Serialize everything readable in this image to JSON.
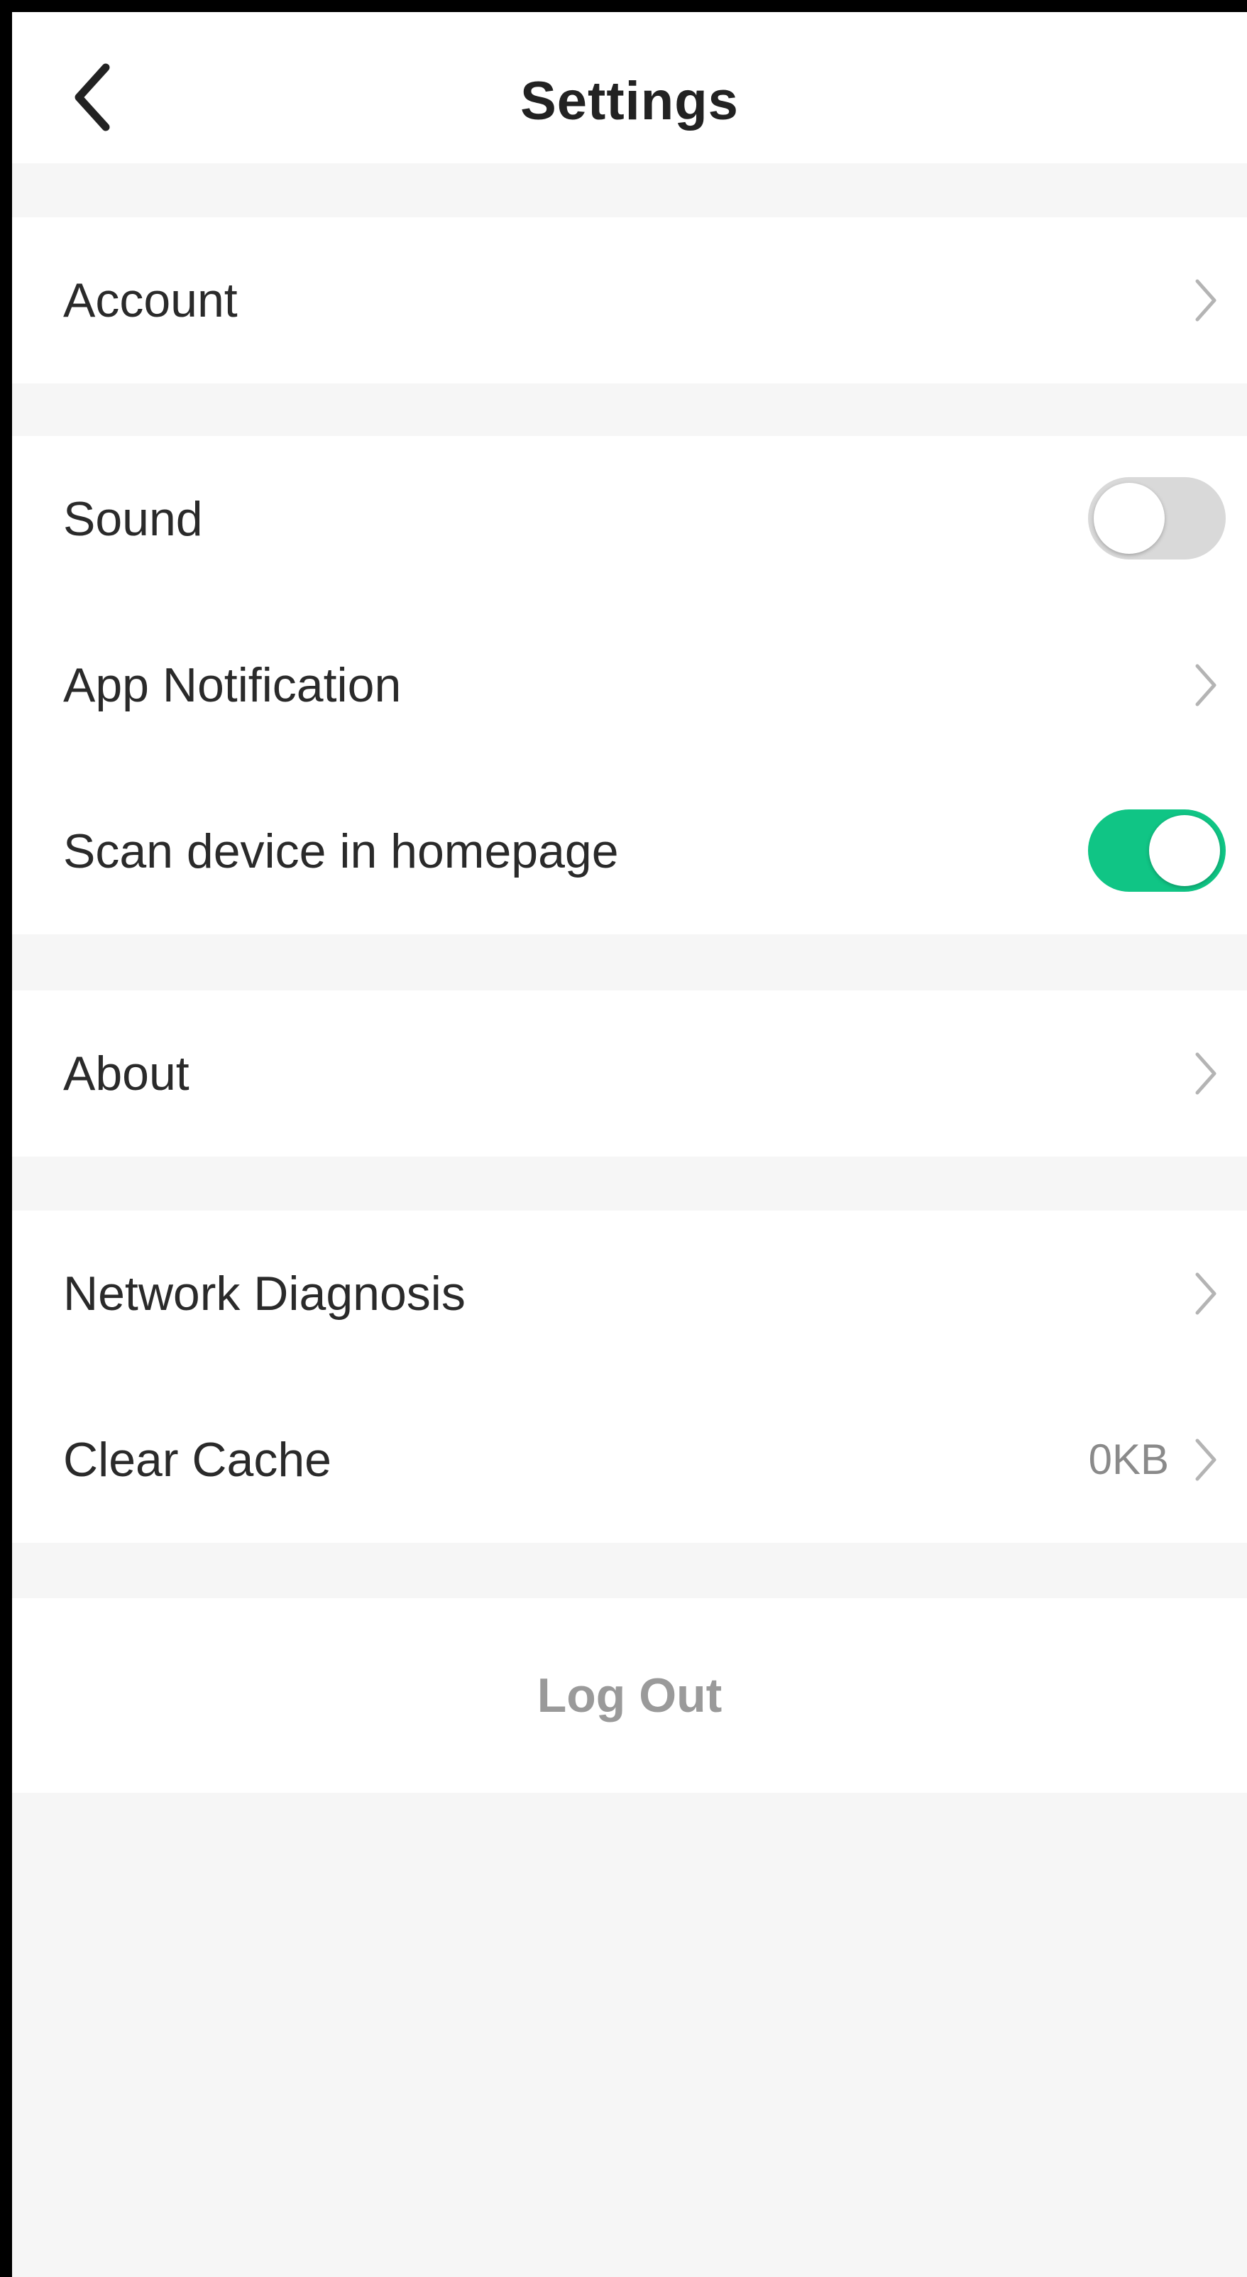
{
  "header": {
    "title": "Settings",
    "back_icon": "chevron-left-icon"
  },
  "sections": {
    "account": {
      "label": "Account"
    },
    "sound": {
      "label": "Sound",
      "enabled": false
    },
    "app_notification": {
      "label": "App Notification"
    },
    "scan_device": {
      "label": "Scan device in homepage",
      "enabled": true
    },
    "about": {
      "label": "About"
    },
    "network_diagnosis": {
      "label": "Network Diagnosis"
    },
    "clear_cache": {
      "label": "Clear Cache",
      "value": "0KB"
    }
  },
  "logout": {
    "label": "Log Out"
  },
  "colors": {
    "toggle_on": "#10c585",
    "toggle_off": "#d9d9d9",
    "page_background": "#f6f6f6",
    "chevron": "#b4b4b4"
  }
}
